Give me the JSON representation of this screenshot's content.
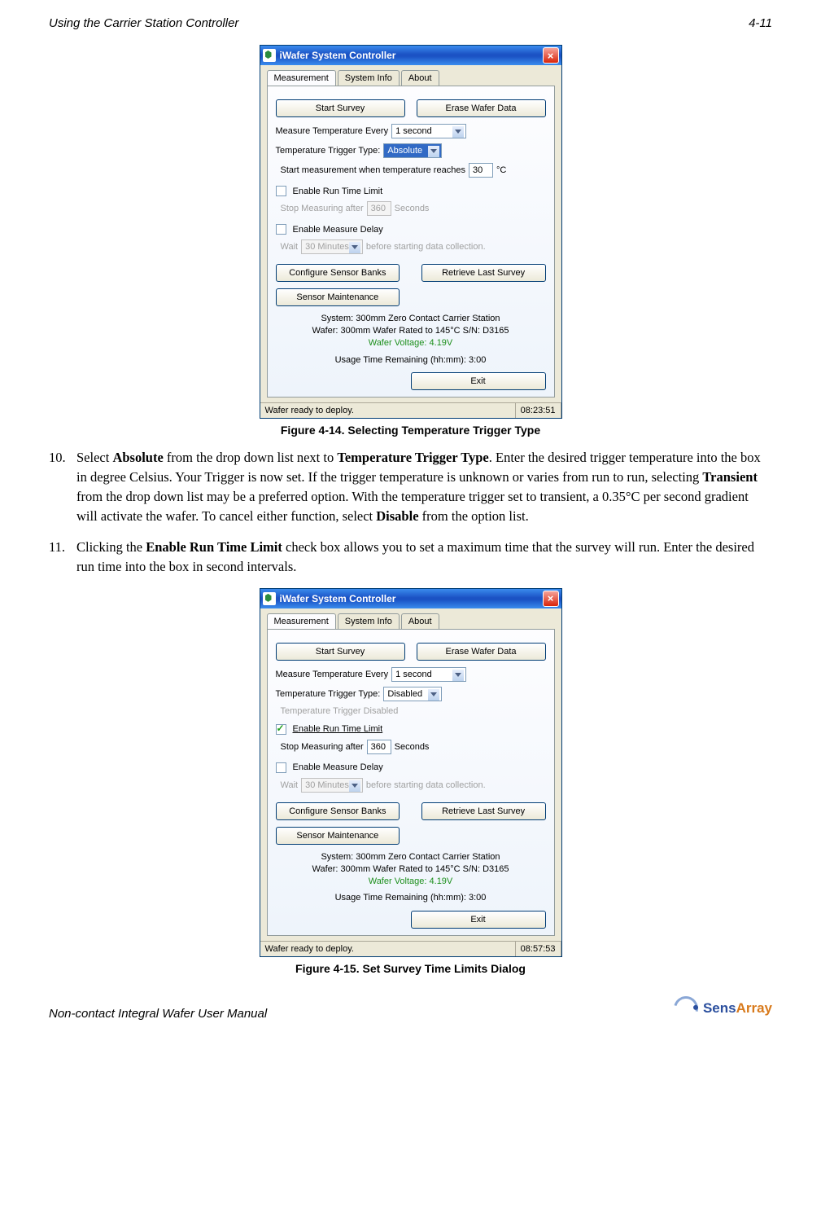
{
  "header": {
    "left": "Using the Carrier Station Controller",
    "right": "4-11"
  },
  "figA": {
    "title": "iWafer System Controller",
    "tabs": [
      "Measurement",
      "System Info",
      "About"
    ],
    "btn_start": "Start Survey",
    "btn_erase": "Erase Wafer Data",
    "measure_label": "Measure Temperature Every",
    "measure_value": "1 second",
    "trigger_type_label": "Temperature Trigger Type:",
    "trigger_type_value": "Absolute",
    "trigger_reach_label": "Start measurement when temperature reaches",
    "trigger_reach_value": "30",
    "trigger_reach_unit": "°C",
    "runlimit_label": "Enable Run Time Limit",
    "runlimit_checked": false,
    "stop_after_label": "Stop Measuring after",
    "stop_after_value": "360",
    "stop_after_unit": "Seconds",
    "delay_label": "Enable Measure Delay",
    "delay_checked": false,
    "wait_label": "Wait",
    "wait_value": "30 Minutes",
    "wait_tail": "before starting data collection.",
    "btn_config": "Configure Sensor Banks",
    "btn_retrieve": "Retrieve Last Survey",
    "btn_maint": "Sensor Maintenance",
    "sys_line1": "System: 300mm Zero Contact Carrier Station",
    "sys_line2": "Wafer: 300mm Wafer Rated to 145°C S/N: D3165",
    "voltage": "Wafer Voltage: 4.19V",
    "usage": "Usage Time Remaining (hh:mm): 3:00",
    "btn_exit": "Exit",
    "status_left": "Wafer ready to deploy.",
    "status_right": "08:23:51",
    "caption": "Figure 4-14. Selecting Temperature Trigger Type"
  },
  "step10": {
    "num": "10.",
    "pre": "Select ",
    "b1": "Absolute",
    "t1": " from the drop down list next to ",
    "b2": "Temperature Trigger Type",
    "t2": ".  Enter the desired trigger temperature into the box in degree Celsius.  Your Trigger is now set.  If the trigger temperature is unknown or varies from run to run, selecting ",
    "b3": "Transient",
    "t3": " from the drop down list may be a preferred option.  With the temperature trigger set to transient, a 0.35°C per second gradient will activate the wafer.  To cancel either function, select ",
    "b4": "Disable",
    "t4": " from the option list."
  },
  "step11": {
    "num": "11.",
    "pre": "Clicking the ",
    "b1": "Enable Run Time Limit",
    "t1": " check box allows you to set a maximum time that the survey will run.  Enter the desired run time into the box in second intervals."
  },
  "figB": {
    "trigger_type_value": "Disabled",
    "trigger_disabled_label": "Temperature Trigger Disabled",
    "runlimit_checked": true,
    "status_right": "08:57:53",
    "caption": "Figure 4-15. Set Survey Time Limits Dialog"
  },
  "footer": {
    "left": "Non-contact Integral Wafer User Manual",
    "brand1": "Sens",
    "brand2": "Array"
  }
}
